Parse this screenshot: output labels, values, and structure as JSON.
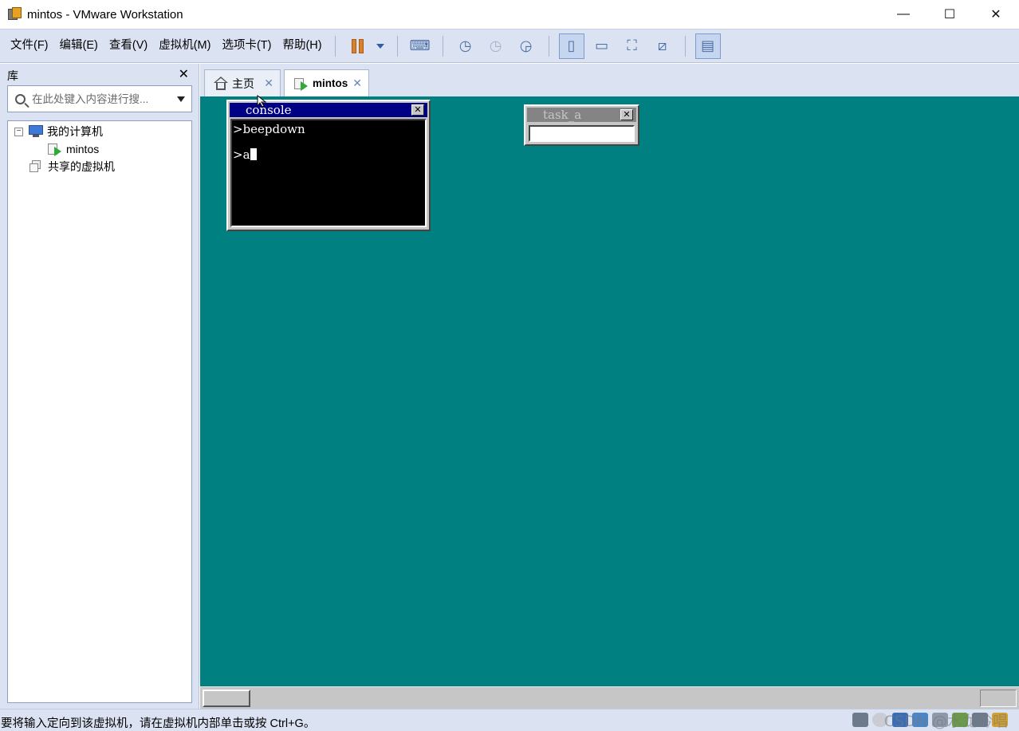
{
  "window": {
    "title": "mintos - VMware Workstation",
    "controls": {
      "minimize": "—",
      "maximize": "☐",
      "close": "✕"
    }
  },
  "menu": {
    "items": [
      "文件(F)",
      "编辑(E)",
      "查看(V)",
      "虚拟机(M)",
      "选项卡(T)",
      "帮助(H)"
    ]
  },
  "toolbar": {
    "buttons": [
      "pause",
      "send-ctrl-alt-del",
      "snapshot-take",
      "snapshot-revert",
      "snapshot-manager",
      "show-library",
      "show-thumbnail",
      "fullscreen",
      "unity",
      "console-view"
    ],
    "accent": "#d9822b"
  },
  "library": {
    "title": "库",
    "close": "✕",
    "search_placeholder": "在此处键入内容进行搜...",
    "tree": {
      "expander": "−",
      "my_computer": "我的计算机",
      "vm": "mintos",
      "shared": "共享的虚拟机"
    }
  },
  "tabs": [
    {
      "label": "主页",
      "close": "✕"
    },
    {
      "label": "mintos",
      "close": "✕"
    }
  ],
  "guest": {
    "desktop_color": "#008080",
    "console": {
      "title": "console",
      "close": "✕",
      "lines": [
        ">beepdown",
        ">a"
      ],
      "titlebar_color": "#000084"
    },
    "task_a": {
      "title": "task_a",
      "close": "✕",
      "titlebar_color": "#848484"
    }
  },
  "status": {
    "message": "要将输入定向到该虚拟机，请在虚拟机内部单击或按 Ctrl+G。",
    "watermark": "CSDN @水龙吟唱"
  }
}
